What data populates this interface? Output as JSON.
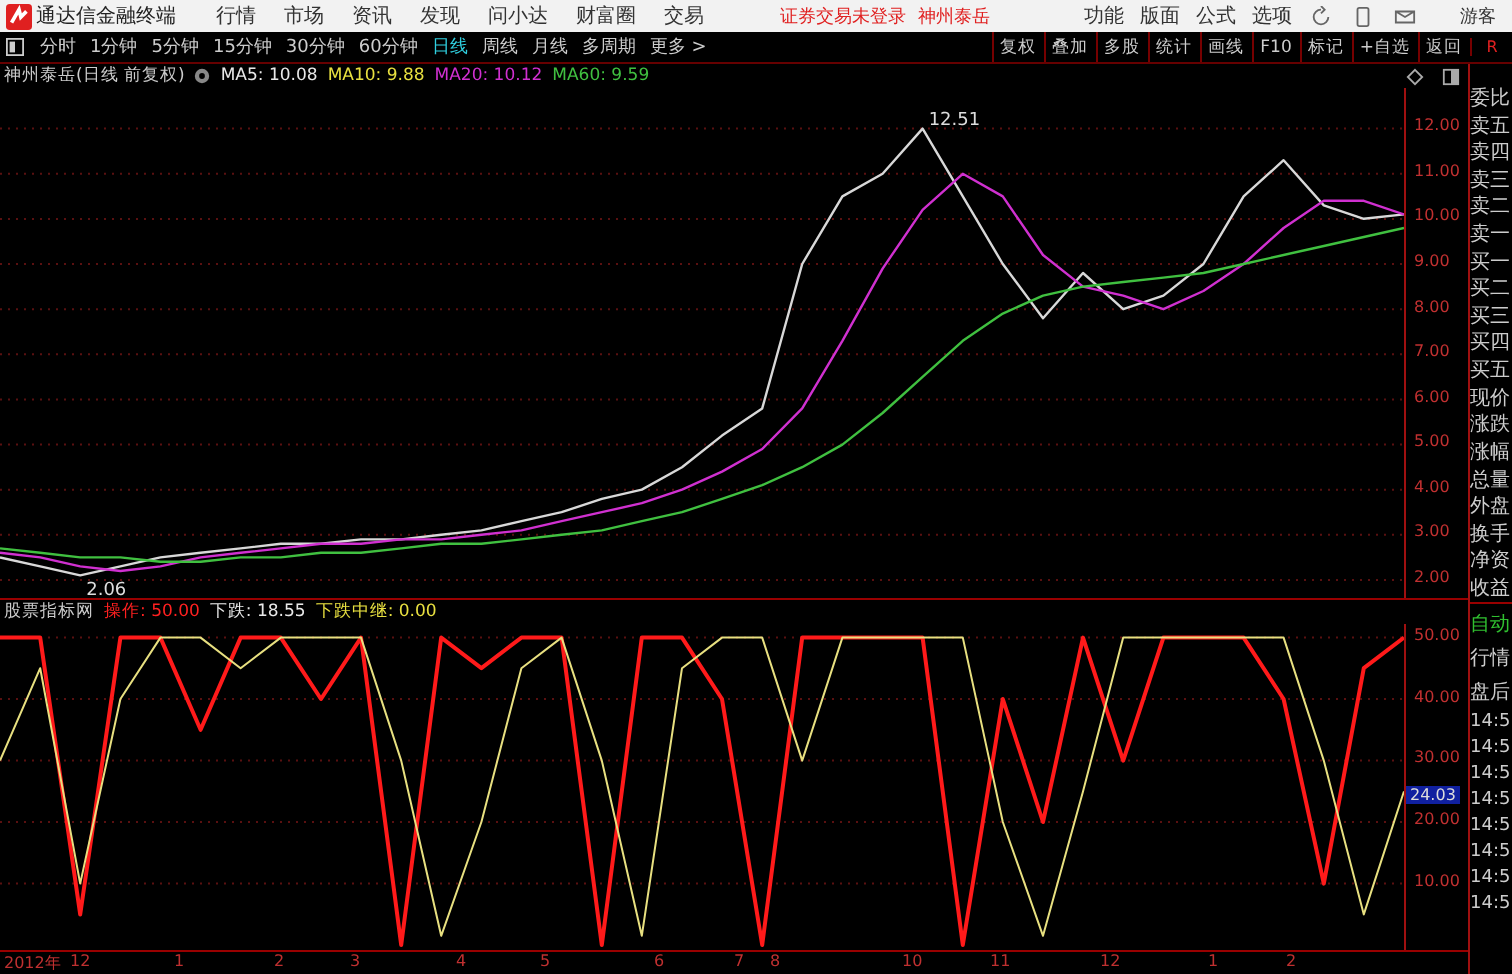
{
  "menu_bar": {
    "app_title": "通达信金融终端",
    "menu": [
      "行情",
      "市场",
      "资讯",
      "发现",
      "问小达",
      "财富圈",
      "交易"
    ],
    "login_notice": "证券交易未登录",
    "stock_name": "神州泰岳",
    "right_menu": [
      "功能",
      "版面",
      "公式",
      "选项"
    ],
    "user": "游客"
  },
  "toolbar": {
    "periods": [
      {
        "label": "分时",
        "selected": false
      },
      {
        "label": "1分钟",
        "selected": false
      },
      {
        "label": "5分钟",
        "selected": false
      },
      {
        "label": "15分钟",
        "selected": false
      },
      {
        "label": "30分钟",
        "selected": false
      },
      {
        "label": "60分钟",
        "selected": false
      },
      {
        "label": "日线",
        "selected": true
      },
      {
        "label": "周线",
        "selected": false
      },
      {
        "label": "月线",
        "selected": false
      },
      {
        "label": "多周期",
        "selected": false
      },
      {
        "label": "更多 >",
        "selected": false
      }
    ],
    "actions": [
      "复权",
      "叠加",
      "多股",
      "统计",
      "画线",
      "F10",
      "标记",
      "+自选",
      "返回"
    ],
    "corner_label": "R"
  },
  "price_panel": {
    "title": "神州泰岳(日线 前复权)",
    "indicators": [
      {
        "text": "MA5: 10.08",
        "color": "#e8e8e8"
      },
      {
        "text": "MA10: 9.88",
        "color": "#e8e040"
      },
      {
        "text": "MA20: 10.12",
        "color": "#d030d0"
      },
      {
        "text": "MA60: 9.59",
        "color": "#40c040"
      }
    ],
    "chart_data": {
      "type": "line",
      "grid": true,
      "ylim": [
        1.6,
        12.9
      ],
      "yticks": [
        {
          "value": 2,
          "label": "2.00"
        },
        {
          "value": 3,
          "label": "3.00"
        },
        {
          "value": 4,
          "label": "4.00"
        },
        {
          "value": 5,
          "label": "5.00"
        },
        {
          "value": 6,
          "label": "6.00"
        },
        {
          "value": 7,
          "label": "7.00"
        },
        {
          "value": 8,
          "label": "8.00"
        },
        {
          "value": 9,
          "label": "9.00"
        },
        {
          "value": 10,
          "label": "10.00"
        },
        {
          "value": 11,
          "label": "11.00"
        },
        {
          "value": 12,
          "label": "12.00"
        }
      ],
      "series": [
        {
          "color": "#d8d8d8",
          "values": [
            2.5,
            2.3,
            2.1,
            2.3,
            2.5,
            2.6,
            2.7,
            2.8,
            2.8,
            2.9,
            2.9,
            3.0,
            3.1,
            3.3,
            3.5,
            3.8,
            4.0,
            4.5,
            5.2,
            5.8,
            9.0,
            10.5,
            11.0,
            12.0,
            10.5,
            9.0,
            7.8,
            8.8,
            8.0,
            8.3,
            9.0,
            10.5,
            11.3,
            10.3,
            10.0,
            10.1
          ]
        },
        {
          "color": "#d030d0",
          "values": [
            2.6,
            2.5,
            2.3,
            2.2,
            2.3,
            2.5,
            2.6,
            2.7,
            2.8,
            2.8,
            2.9,
            2.9,
            3.0,
            3.1,
            3.3,
            3.5,
            3.7,
            4.0,
            4.4,
            4.9,
            5.8,
            7.3,
            8.9,
            10.2,
            11.0,
            10.5,
            9.2,
            8.5,
            8.3,
            8.0,
            8.4,
            9.0,
            9.8,
            10.4,
            10.4,
            10.1
          ]
        },
        {
          "color": "#40c040",
          "values": [
            2.7,
            2.6,
            2.5,
            2.5,
            2.4,
            2.4,
            2.5,
            2.5,
            2.6,
            2.6,
            2.7,
            2.8,
            2.8,
            2.9,
            3.0,
            3.1,
            3.3,
            3.5,
            3.8,
            4.1,
            4.5,
            5.0,
            5.7,
            6.5,
            7.3,
            7.9,
            8.3,
            8.5,
            8.6,
            8.7,
            8.8,
            9.0,
            9.2,
            9.4,
            9.6,
            9.8
          ]
        }
      ],
      "annotations": [
        "12.51",
        "2.06"
      ]
    }
  },
  "indicator_panel": {
    "title": "股票指标网",
    "readings": [
      {
        "text": "操作: 50.00",
        "color": "#ff2020"
      },
      {
        "text": "下跌: 18.55",
        "color": "#e8e8e8"
      },
      {
        "text": "下跌中继: 0.00",
        "color": "#e8e040"
      }
    ],
    "current_value": "24.03",
    "date_labels": [
      "2012年",
      "12",
      "1",
      "2",
      "3",
      "4",
      "5",
      "6",
      "7",
      "8",
      "10",
      "11",
      "12",
      "1",
      "2"
    ],
    "chart_data": {
      "type": "line",
      "grid": true,
      "ylim": [
        -0.8,
        52.2
      ],
      "yticks": [
        {
          "value": 10,
          "label": "10.00"
        },
        {
          "value": 20,
          "label": "20.00"
        },
        {
          "value": 30,
          "label": "30.00"
        },
        {
          "value": 40,
          "label": "40.00"
        },
        {
          "value": 50,
          "label": "50.00"
        }
      ],
      "series": [
        {
          "color": "#ff1a1a",
          "values": [
            50,
            50,
            5,
            50,
            50,
            35,
            50,
            50,
            40,
            50,
            0,
            50,
            45,
            50,
            50,
            0,
            50,
            50,
            40,
            0,
            50,
            50,
            50,
            50,
            0,
            40,
            20,
            50,
            30,
            50,
            50,
            50,
            40,
            10,
            45,
            50
          ]
        },
        {
          "color": "#e8e080",
          "values": [
            30,
            45,
            10,
            40,
            50,
            50,
            45,
            50,
            50,
            50,
            30,
            1.5,
            20,
            45,
            50,
            30,
            1.5,
            45,
            50,
            50,
            30,
            50,
            50,
            50,
            50,
            20,
            1.5,
            25,
            50,
            50,
            50,
            50,
            50,
            30,
            5,
            25
          ]
        }
      ]
    }
  },
  "quote_labels": [
    "委比",
    "卖五",
    "卖四",
    "卖三",
    "卖二",
    "卖一",
    "买一",
    "买二",
    "买三",
    "买四",
    "买五",
    "现价",
    "涨跌",
    "涨幅",
    "总量",
    "外盘",
    "换手",
    "净资",
    "收益"
  ],
  "trade_panel": {
    "mode": "自动",
    "tabs": [
      "行情",
      "盘后"
    ],
    "times": [
      "14:5",
      "14:5",
      "14:5",
      "14:5",
      "14:5",
      "14:5",
      "14:5",
      "14:5"
    ]
  }
}
